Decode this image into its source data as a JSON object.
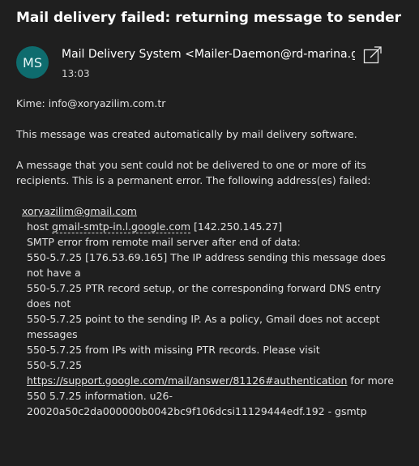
{
  "subject": "Mail delivery failed: returning message to sender",
  "sender": {
    "initials": "MS",
    "avatar_color": "#0e6c6e",
    "name": "Mail Delivery System",
    "address": "<Mailer-Daemon@rd-marina.gu",
    "time": "13:03"
  },
  "icons": {
    "popout": "open-in-new-window-icon"
  },
  "recipient_label": "Kime:",
  "recipient": "info@xoryazilim.com.tr",
  "body": {
    "line1": "This message was created automatically by mail delivery software.",
    "line2": "A message that you sent could not be delivered to one or more of its recipients. This is a permanent error. The following address(es) failed:",
    "failed_address": "xoryazilim@gmail.com",
    "host_prefix": "host ",
    "host_name": "gmail-smtp-in.l.google.com",
    "host_ip": " [142.250.145.27]",
    "smtp_line": "SMTP error from remote mail server after end of data:",
    "err1": "550-5.7.25 [176.53.69.165] The IP address sending this message does not have a",
    "err2": "550-5.7.25 PTR record setup, or the corresponding forward DNS entry does not",
    "err3": "550-5.7.25 point to the sending IP. As a policy, Gmail does not accept messages",
    "err4": "550-5.7.25 from IPs with missing PTR records. Please visit",
    "err5_prefix": "550-5.7.25 ",
    "err5_link": "https://support.google.com/mail/answer/81126#authentication",
    "err5_suffix": " for more",
    "err6": "550 5.7.25 information. u26-20020a50c2da000000b0042bc9f106dcsi11129444edf.192 - gsmtp"
  }
}
